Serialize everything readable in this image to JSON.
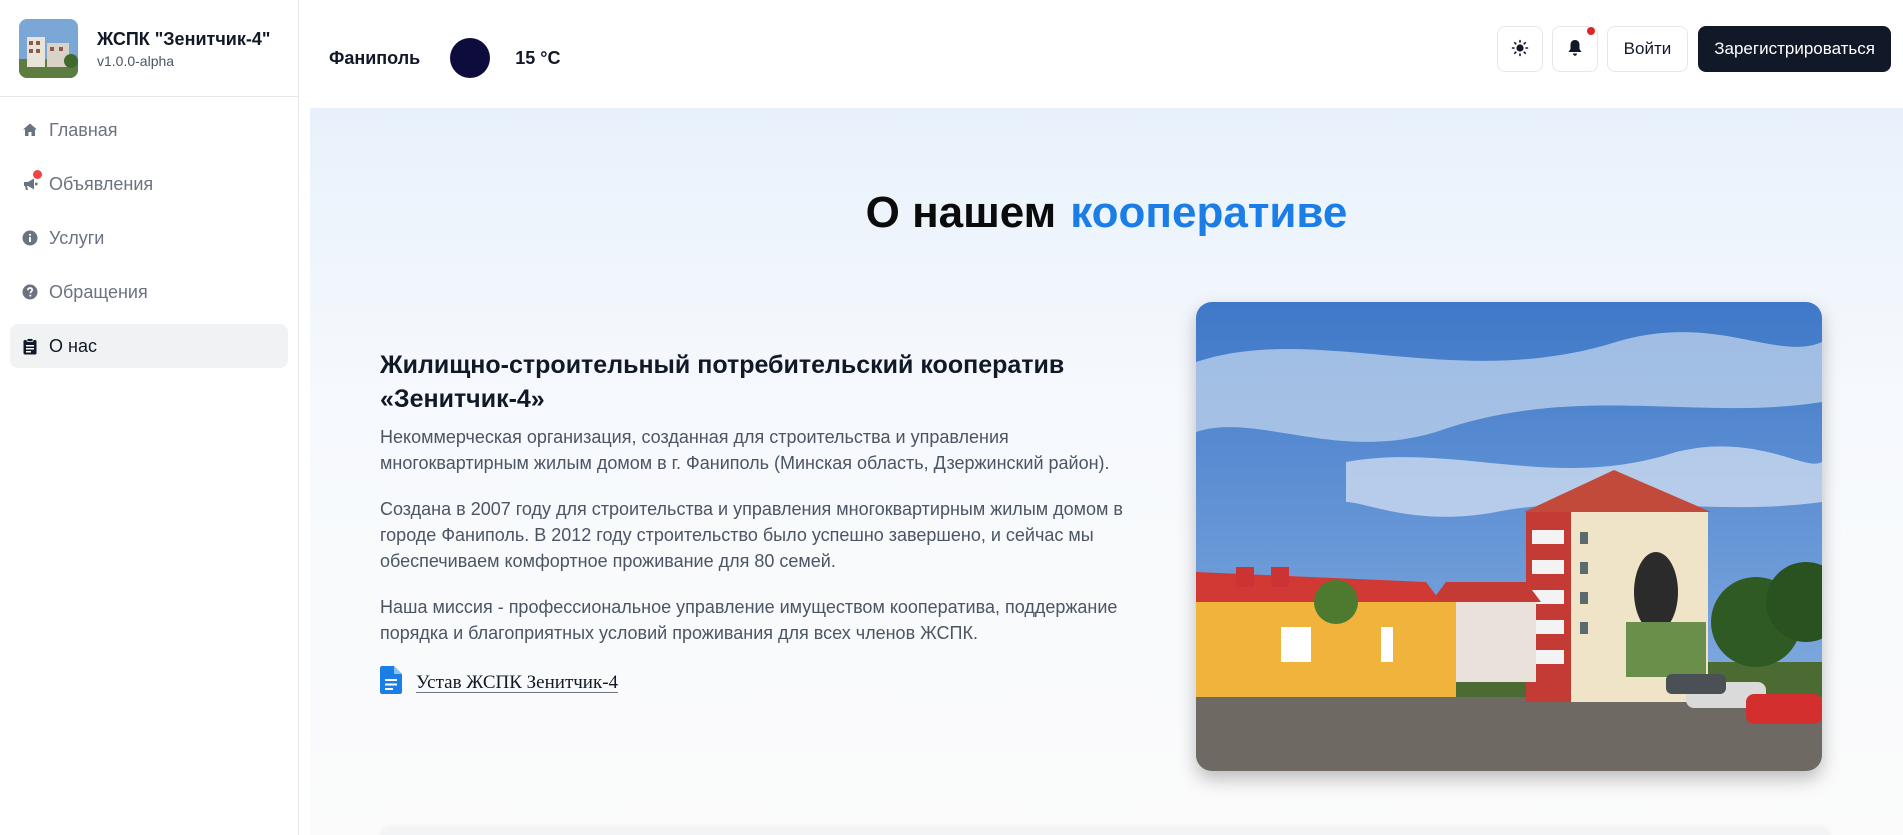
{
  "brand": {
    "title": "ЖСПК \"Зенитчик-4\"",
    "version": "v1.0.0-alpha",
    "logo_icon": "building-photo"
  },
  "sidebar": {
    "items": [
      {
        "label": "Главная",
        "icon": "home-icon",
        "active": false
      },
      {
        "label": "Объявления",
        "icon": "megaphone-icon",
        "active": false,
        "has_badge": true
      },
      {
        "label": "Услуги",
        "icon": "info-icon",
        "active": false
      },
      {
        "label": "Обращения",
        "icon": "question-icon",
        "active": false
      },
      {
        "label": "О нас",
        "icon": "clipboard-icon",
        "active": true
      }
    ]
  },
  "header": {
    "city": "Фаниполь",
    "temperature": "15 °C",
    "theme_toggle_icon": "sun-icon",
    "notifications_icon": "bell-icon",
    "has_notification": true,
    "login_label": "Войти",
    "register_label": "Зарегистрироваться"
  },
  "about": {
    "title_main": "О нашем",
    "title_accent": "кооперативе",
    "org_title": "Жилищно-строительный потребительский кооператив «Зенитчик-4»",
    "paragraphs": [
      "Некоммерческая организация, созданная для строительства и управления многоквартирным жилым домом в г. Фаниполь (Минская область, Дзержинский район).",
      "Создана в 2007 году для строительства и управления многоквартирным жилым домом в городе Фаниполь. В 2012 году строительство было успешно завершено, и сейчас мы обеспечиваем комфортное проживание для 80 семей.",
      "Наша миссия - профессиональное управление имуществом кооператива, поддержание порядка и благоприятных условий проживания для всех членов ЖСПК."
    ],
    "document_link": "Устав ЖСПК Зенитчик-4",
    "document_icon": "document-icon"
  },
  "colors": {
    "accent": "#1a7ee6",
    "primary_button": "#111827",
    "notification": "#dc2626"
  }
}
